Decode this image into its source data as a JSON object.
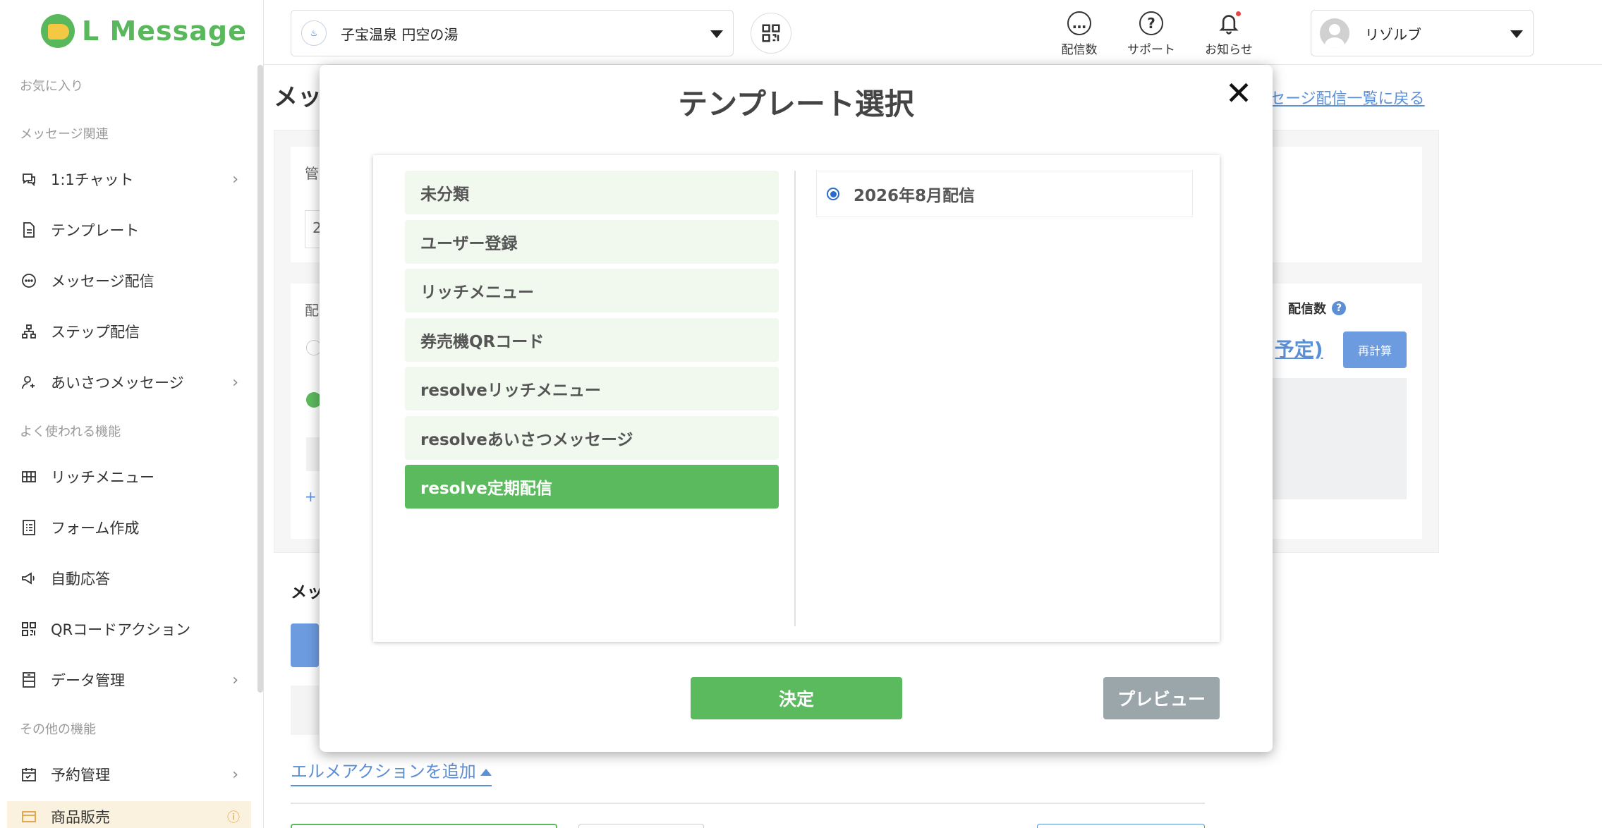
{
  "sidebar": {
    "logo_text": "L Message",
    "sections": {
      "favorites": "お気に入り",
      "message": "メッセージ関連",
      "frequent": "よく使われる機能",
      "other": "その他の機能"
    },
    "items": [
      {
        "label": "1:1チャット",
        "icon": "chat-bubbles-icon",
        "chevron": true
      },
      {
        "label": "テンプレート",
        "icon": "document-icon",
        "chevron": false
      },
      {
        "label": "メッセージ配信",
        "icon": "message-bubble-icon",
        "chevron": false
      },
      {
        "label": "ステップ配信",
        "icon": "hierarchy-icon",
        "chevron": false
      },
      {
        "label": "あいさつメッセージ",
        "icon": "user-plus-icon",
        "chevron": true
      },
      {
        "label": "リッチメニュー",
        "icon": "grid-icon",
        "chevron": false
      },
      {
        "label": "フォーム作成",
        "icon": "list-form-icon",
        "chevron": false
      },
      {
        "label": "自動応答",
        "icon": "megaphone-icon",
        "chevron": false
      },
      {
        "label": "QRコードアクション",
        "icon": "qr-code-icon",
        "chevron": false
      },
      {
        "label": "データ管理",
        "icon": "database-icon",
        "chevron": true
      },
      {
        "label": "予約管理",
        "icon": "calendar-icon",
        "chevron": true
      },
      {
        "label": "商品販売",
        "icon": "card-icon",
        "chevron": false
      }
    ]
  },
  "topbar": {
    "account_name": "子宝温泉 円空の湯",
    "actions": {
      "delivery_count": "配信数",
      "support": "サポート",
      "notifications": "お知らせ"
    },
    "user_name": "リゾルブ"
  },
  "background": {
    "title": "メッ",
    "back_link": "ッセージ配信一覧に戻る",
    "stat_label": "配信数",
    "stat_help": "?",
    "scheduled": "(予定)",
    "recalc": "再計算",
    "add_action": "エルメアクションを追加",
    "fragments": {
      "mgmt": "管",
      "value": "2",
      "deliv": "配",
      "plus": "+",
      "msg": "メッ"
    }
  },
  "modal": {
    "title": "テンプレート選択",
    "close": "✕",
    "folders": [
      {
        "label": "未分類",
        "active": false
      },
      {
        "label": "ユーザー登録",
        "active": false
      },
      {
        "label": "リッチメニュー",
        "active": false
      },
      {
        "label": "券売機QRコード",
        "active": false
      },
      {
        "label": "resolveリッチメニュー",
        "active": false
      },
      {
        "label": "resolveあいさつメッセージ",
        "active": false
      },
      {
        "label": "resolve定期配信",
        "active": true
      }
    ],
    "templates": [
      {
        "label": "2026年8月配信",
        "selected": true
      }
    ],
    "confirm_label": "決定",
    "preview_label": "プレビュー"
  },
  "colors": {
    "brand_green": "#5cba5e",
    "link_blue": "#5b8fd6",
    "preview_gray": "#9aa6aa"
  }
}
